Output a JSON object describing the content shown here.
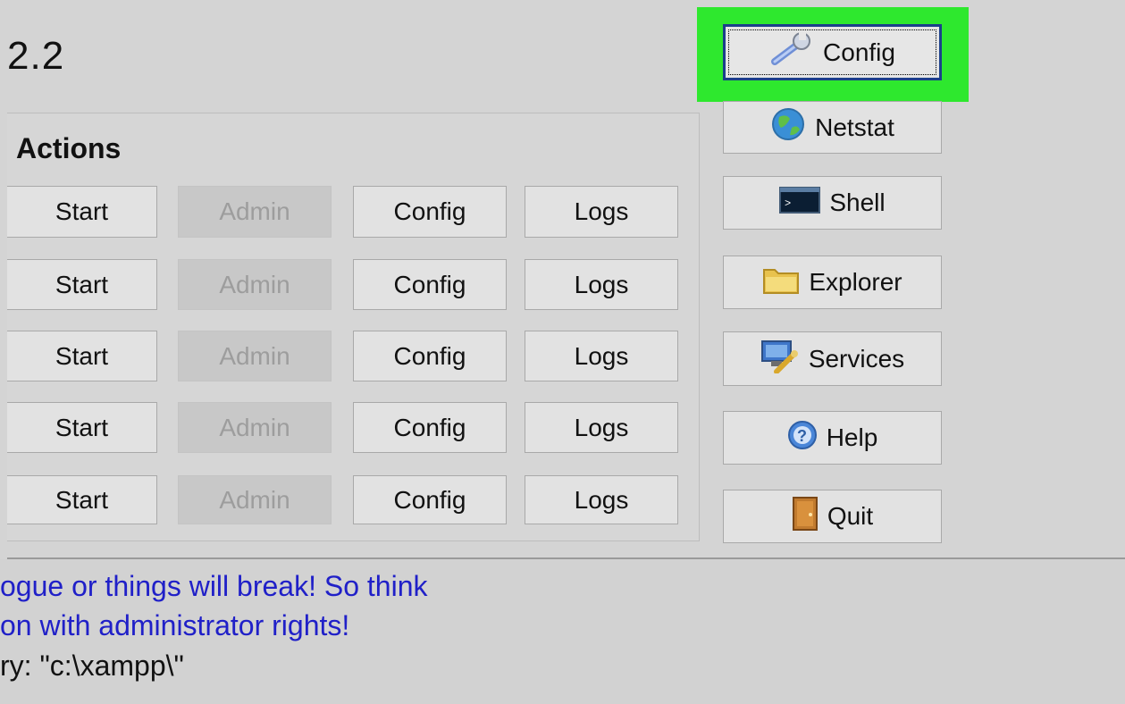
{
  "header": {
    "version_text": "2.2"
  },
  "actions": {
    "title": "Actions",
    "rows": [
      {
        "start": "Start",
        "admin": "Admin",
        "config": "Config",
        "logs": "Logs"
      },
      {
        "start": "Start",
        "admin": "Admin",
        "config": "Config",
        "logs": "Logs"
      },
      {
        "start": "Start",
        "admin": "Admin",
        "config": "Config",
        "logs": "Logs"
      },
      {
        "start": "Start",
        "admin": "Admin",
        "config": "Config",
        "logs": "Logs"
      },
      {
        "start": "Start",
        "admin": "Admin",
        "config": "Config",
        "logs": "Logs"
      }
    ]
  },
  "sidebar": {
    "config": {
      "label": "Config",
      "icon": "wrench-icon"
    },
    "netstat": {
      "label": "Netstat",
      "icon": "globe-icon"
    },
    "shell": {
      "label": "Shell",
      "icon": "terminal-icon"
    },
    "explorer": {
      "label": "Explorer",
      "icon": "folder-icon"
    },
    "services": {
      "label": "Services",
      "icon": "services-icon"
    },
    "help": {
      "label": "Help",
      "icon": "help-icon"
    },
    "quit": {
      "label": "Quit",
      "icon": "door-icon"
    }
  },
  "log": {
    "line1": "ogue or things will break! So think",
    "line2": "on with administrator rights!",
    "line3": "ry: \"c:\\xampp\\\""
  },
  "colors": {
    "highlight": "#2ee82e",
    "log_blue": "#2020c8",
    "focus_border": "#1b3f8a"
  }
}
